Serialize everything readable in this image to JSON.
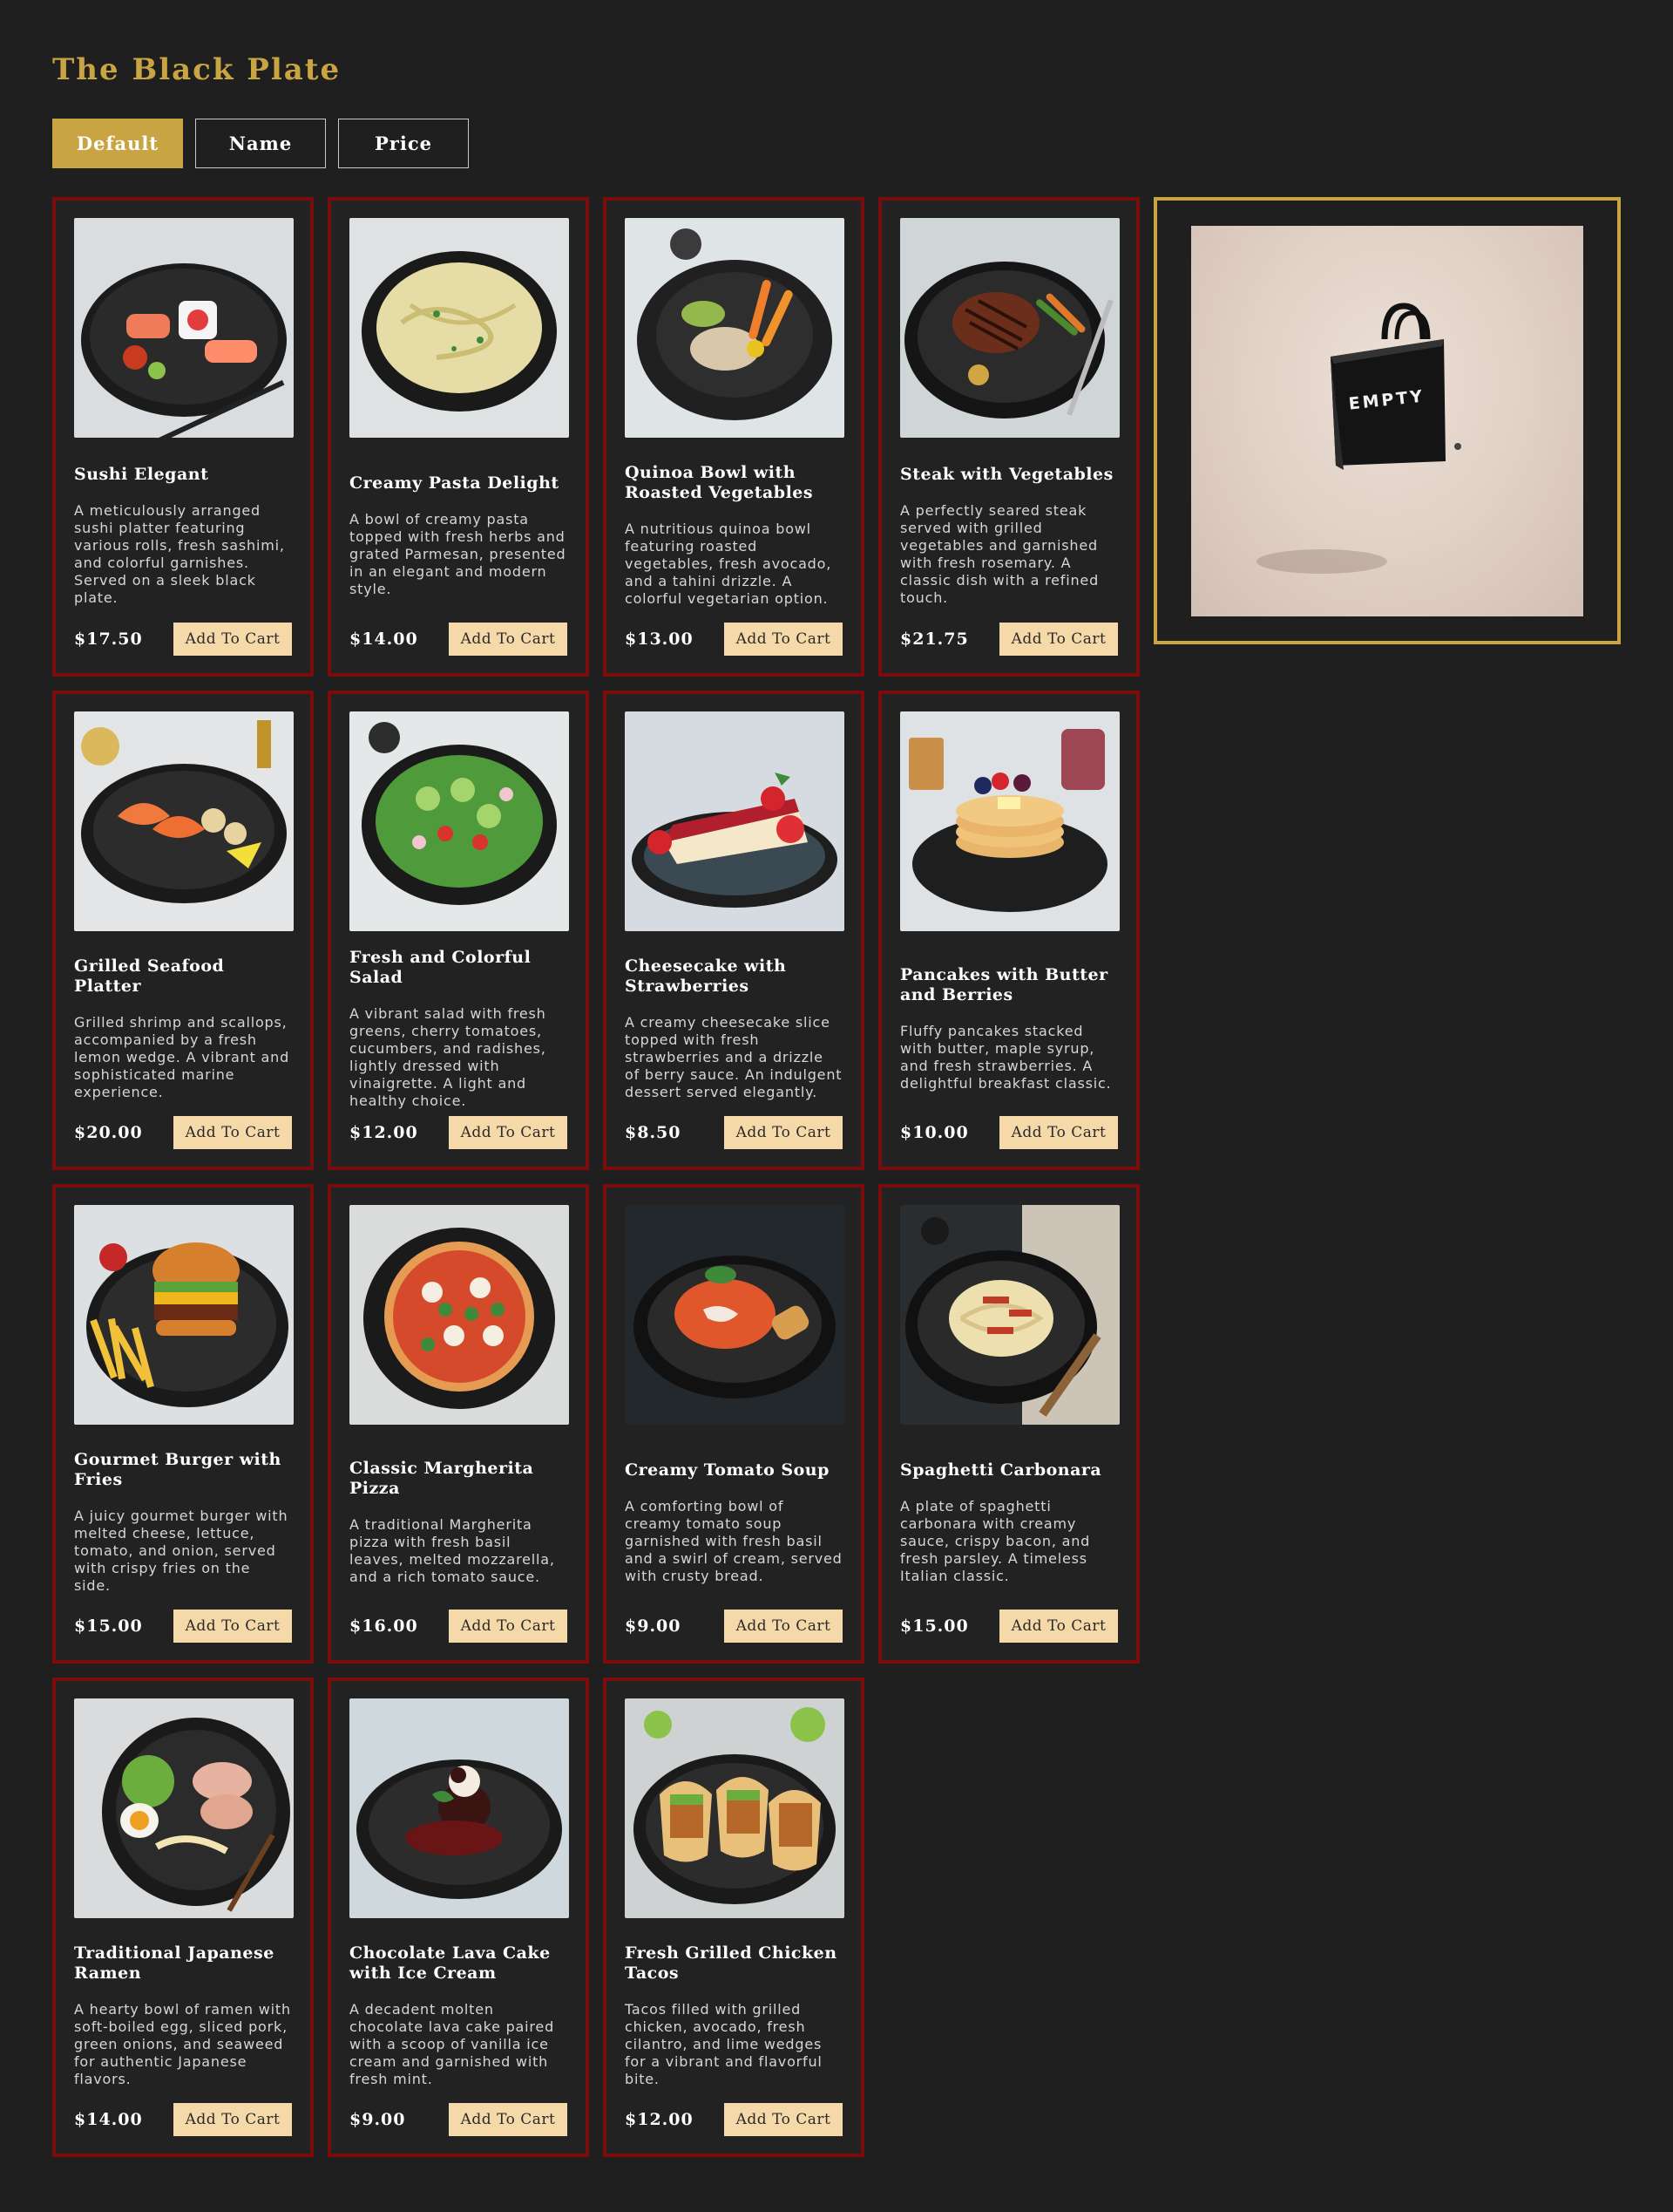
{
  "brand": {
    "title": "The Black Plate",
    "accent": "#c9a443",
    "card_border": "#7a0c0c"
  },
  "sort": {
    "options": [
      {
        "label": "Default",
        "active": true
      },
      {
        "label": "Name",
        "active": false
      },
      {
        "label": "Price",
        "active": false
      }
    ]
  },
  "products": [
    {
      "name": "Sushi Elegant",
      "description": "A meticulously arranged sushi platter featuring various rolls, fresh sashimi, and colorful garnishes. Served on a sleek black plate.",
      "price": "$17.50",
      "button": "Add To Cart",
      "image": "sushi-image"
    },
    {
      "name": "Creamy Pasta Delight",
      "description": "A bowl of creamy pasta topped with fresh herbs and grated Parmesan, presented in an elegant and modern style.",
      "price": "$14.00",
      "button": "Add To Cart",
      "image": "pasta-image"
    },
    {
      "name": "Quinoa Bowl with Roasted Vegetables",
      "description": "A nutritious quinoa bowl featuring roasted vegetables, fresh avocado, and a tahini drizzle. A colorful vegetarian option.",
      "price": "$13.00",
      "button": "Add To Cart",
      "image": "quinoa-bowl-image"
    },
    {
      "name": "Steak with Vegetables",
      "description": "A perfectly seared steak served with grilled vegetables and garnished with fresh rosemary. A classic dish with a refined touch.",
      "price": "$21.75",
      "button": "Add To Cart",
      "image": "steak-image"
    },
    {
      "name": "Grilled Seafood Platter",
      "description": "Grilled shrimp and scallops, accompanied by a fresh lemon wedge. A vibrant and sophisticated marine experience.",
      "price": "$20.00",
      "button": "Add To Cart",
      "image": "seafood-image"
    },
    {
      "name": "Fresh and Colorful Salad",
      "description": "A vibrant salad with fresh greens, cherry tomatoes, cucumbers, and radishes, lightly dressed with vinaigrette. A light and healthy choice.",
      "price": "$12.00",
      "button": "Add To Cart",
      "image": "salad-image"
    },
    {
      "name": "Cheesecake with Strawberries",
      "description": "A creamy cheesecake slice topped with fresh strawberries and a drizzle of berry sauce. An indulgent dessert served elegantly.",
      "price": "$8.50",
      "button": "Add To Cart",
      "image": "cheesecake-image"
    },
    {
      "name": "Pancakes with Butter and Berries",
      "description": "Fluffy pancakes stacked with butter, maple syrup, and fresh strawberries. A delightful breakfast classic.",
      "price": "$10.00",
      "button": "Add To Cart",
      "image": "pancakes-image"
    },
    {
      "name": "Gourmet Burger with Fries",
      "description": "A juicy gourmet burger with melted cheese, lettuce, tomato, and onion, served with crispy fries on the side.",
      "price": "$15.00",
      "button": "Add To Cart",
      "image": "burger-image"
    },
    {
      "name": "Classic Margherita Pizza",
      "description": "A traditional Margherita pizza with fresh basil leaves, melted mozzarella, and a rich tomato sauce.",
      "price": "$16.00",
      "button": "Add To Cart",
      "image": "pizza-image"
    },
    {
      "name": "Creamy Tomato Soup",
      "description": "A comforting bowl of creamy tomato soup garnished with fresh basil and a swirl of cream, served with crusty bread.",
      "price": "$9.00",
      "button": "Add To Cart",
      "image": "tomato-soup-image"
    },
    {
      "name": "Spaghetti Carbonara",
      "description": "A plate of spaghetti carbonara with creamy sauce, crispy bacon, and fresh parsley. A timeless Italian classic.",
      "price": "$15.00",
      "button": "Add To Cart",
      "image": "carbonara-image"
    },
    {
      "name": "Traditional Japanese Ramen",
      "description": "A hearty bowl of ramen with soft-boiled egg, sliced pork, green onions, and seaweed for authentic Japanese flavors.",
      "price": "$14.00",
      "button": "Add To Cart",
      "image": "ramen-image"
    },
    {
      "name": "Chocolate Lava Cake with Ice Cream",
      "description": "A decadent molten chocolate lava cake paired with a scoop of vanilla ice cream and garnished with fresh mint.",
      "price": "$9.00",
      "button": "Add To Cart",
      "image": "lava-cake-image"
    },
    {
      "name": "Fresh Grilled Chicken Tacos",
      "description": "Tacos filled with grilled chicken, avocado, fresh cilantro, and lime wedges for a vibrant and flavorful bite.",
      "price": "$12.00",
      "button": "Add To Cart",
      "image": "tacos-image"
    }
  ],
  "cart": {
    "bag_label": "EMPTY",
    "image": "empty-shopping-bag-image"
  }
}
